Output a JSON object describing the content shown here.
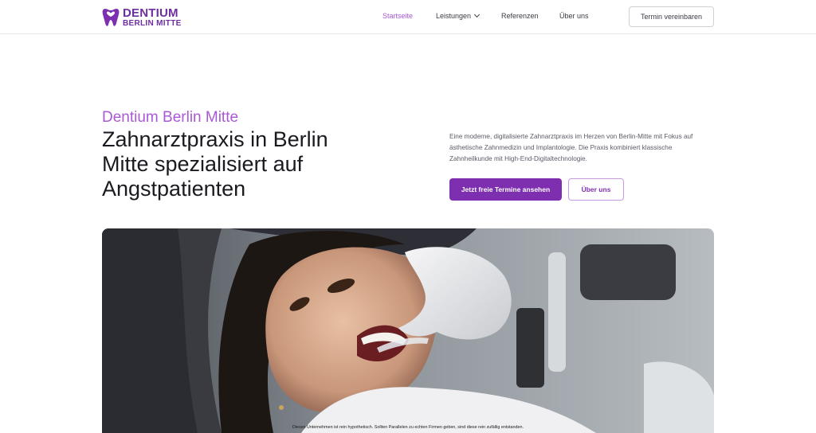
{
  "brand": {
    "name_top": "DENTIUM",
    "name_bottom": "BERLIN MITTE",
    "accent": "#7d2fb0",
    "accent_light": "#a958d6"
  },
  "nav": {
    "items": [
      {
        "label": "Startseite",
        "active": true
      },
      {
        "label": "Leistungen",
        "has_dropdown": true
      },
      {
        "label": "Referenzen"
      },
      {
        "label": "Über uns"
      }
    ],
    "cta_label": "Termin vereinbaren"
  },
  "hero": {
    "eyebrow": "Dentium Berlin Mitte",
    "headline": "Zahnarztpraxis in Berlin Mitte spezialisiert auf Angstpatienten",
    "description": "Eine moderne, digitalisierte Zahnarztpraxis im Herzen von Berlin-Mitte mit Fokus auf ästhetische Zahnmedizin und Implantologie. Die Praxis kombiniert klassische Zahnheilkunde mit High-End-Digitaltechnologie.",
    "primary_button": "Jetzt freie Termine ansehen",
    "secondary_button": "Über uns"
  },
  "photo": {
    "disclaimer": "Dieses Unternehmen ist rein hypothetisch. Sollten Parallelen zu echten Firmen geben, sind diese rein zufällig entstanden."
  }
}
